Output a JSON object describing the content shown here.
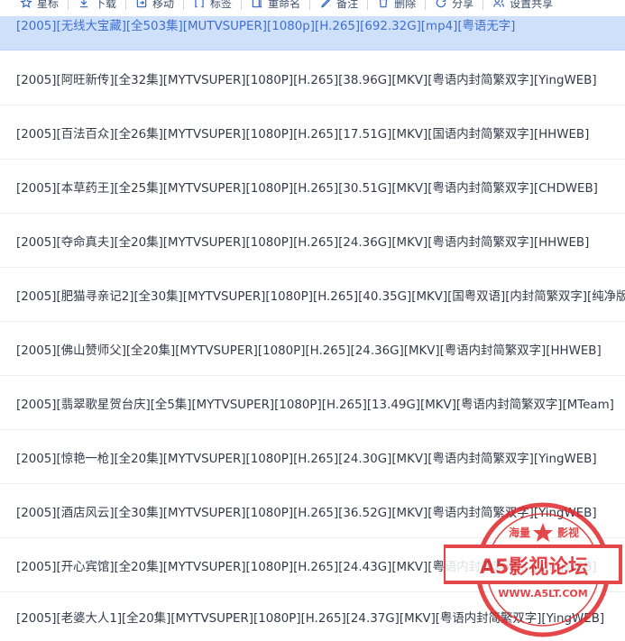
{
  "toolbar": {
    "items": [
      {
        "label": "星标",
        "icon": "star-icon"
      },
      {
        "label": "下载",
        "icon": "download-icon"
      },
      {
        "label": "移动",
        "icon": "move-icon"
      },
      {
        "label": "标签",
        "icon": "tag-icon"
      },
      {
        "label": "重命名",
        "icon": "rename-icon"
      },
      {
        "label": "备注",
        "icon": "note-icon"
      },
      {
        "label": "删除",
        "icon": "trash-icon"
      },
      {
        "label": "分享",
        "icon": "share-icon"
      },
      {
        "label": "设置共享",
        "icon": "users-icon"
      }
    ]
  },
  "files": [
    "[2005][无线大宝藏][全503集][MUTVSUPER][1080p][H.265][692.32G][mp4][粤语无字]",
    "[2005][阿旺新传][全32集][MYTVSUPER][1080P][H.265][38.96G][MKV][粤语内封简繁双字][YingWEB]",
    "[2005][百法百众][全26集][MYTVSUPER][1080P][H.265][17.51G][MKV][国语内封简繁双字][HHWEB]",
    "[2005][本草药王][全25集][MYTVSUPER][1080P][H.265][30.51G][MKV][粤语内封简繁双字][CHDWEB]",
    "[2005][夺命真夫][全20集][MYTVSUPER][1080P][H.265][24.36G][MKV][粤语内封简繁双字][HHWEB]",
    "[2005][肥猫寻亲记2][全30集][MYTVSUPER][1080P][H.265][40.35G][MKV][国粤双语][内封简繁双字][纯净版",
    "[2005][佛山赞师父][全20集][MYTVSUPER][1080P][H.265][24.36G][MKV][粤语内封简繁双字][HHWEB]",
    "[2005][翡翠歌星贺台庆][全5集][MYTVSUPER][1080P][H.265][13.49G][MKV][粤语内封简繁双字][MTeam]",
    "[2005][惊艳一枪][全20集][MYTVSUPER][1080P][H.265][24.30G][MKV][粤语内封简繁双字][YingWEB]",
    "[2005][酒店风云][全30集][MYTVSUPER][1080P][H.265][36.52G][MKV][粤语内封简繁双字][YingWEB]",
    "[2005][开心宾馆][全20集][MYTVSUPER][1080P][H.265][24.43G][MKV][粤语内封简繁双字][YingWEB]",
    "[2005][老婆大人1][全20集][MYTVSUPER][1080P][H.265][24.37G][MKV][粤语内封简繁双字][YingWEB]"
  ],
  "watermark": {
    "top_text": "海量",
    "top_text2": "影视",
    "main_text": "A5影视论坛",
    "url": "WWW.A5LT.COM",
    "color": "#e0262a"
  }
}
